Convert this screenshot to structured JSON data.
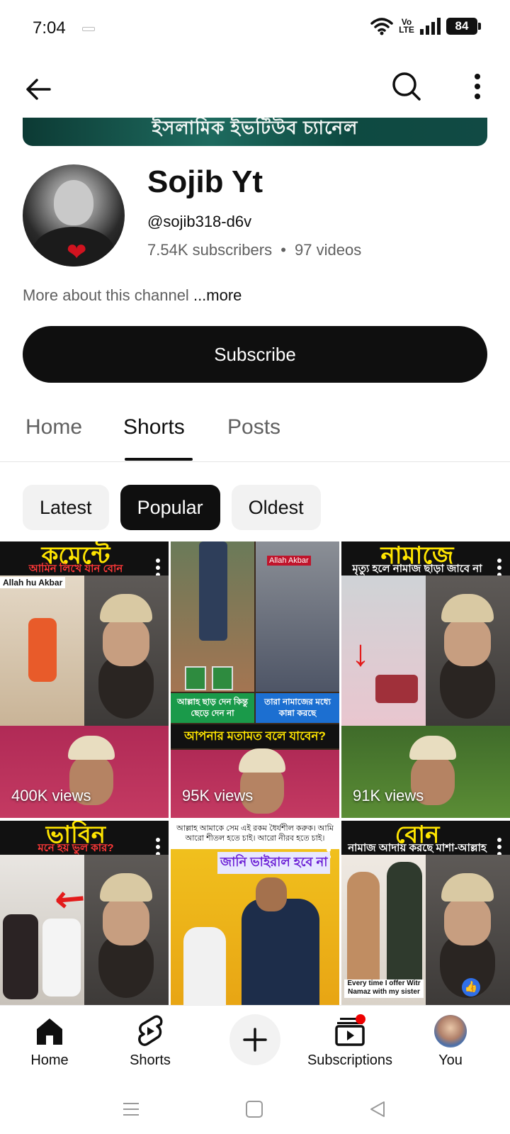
{
  "status_bar": {
    "time": "7:04",
    "network": "Vo LTE",
    "battery": "84"
  },
  "app_bar": {
    "back_icon": "arrow-back-icon",
    "search_icon": "search-icon",
    "more_icon": "more-vertical-icon"
  },
  "banner": {
    "text": "ইসলামিক ইভটিউব চ্যানেল"
  },
  "channel": {
    "name": "Sojib Yt",
    "handle": "@sojib318-d6v",
    "subscribers": "7.54K subscribers",
    "separator": "•",
    "videos": "97 videos",
    "more_about": "More about this channel",
    "more_link": "...more"
  },
  "subscribe_label": "Subscribe",
  "tabs": [
    {
      "label": "Home"
    },
    {
      "label": "Shorts"
    },
    {
      "label": "Posts"
    }
  ],
  "active_tab": "Shorts",
  "chips": [
    {
      "label": "Latest"
    },
    {
      "label": "Popular"
    },
    {
      "label": "Oldest"
    }
  ],
  "active_chip": "Popular",
  "shorts": [
    {
      "headline": "কমেন্টে",
      "subline": "আমিন লিখে যান বোন",
      "caption": "Allah hu Akbar",
      "views": "400K views"
    },
    {
      "headline": "",
      "subline": "",
      "caption": "Allah Akbar",
      "band_left": "আল্লাহ ছাড় দেন কিন্তু ছেড়ে দেন না",
      "band_right": "তারা নামাজের মধ্যে কান্না করছে",
      "band_mid": "আপনার মতামত বলে যাবেন?",
      "views": "95K views"
    },
    {
      "headline": "নামাজে",
      "subline": "মৃত্যু হলে নামাজ ছাড়া জাবে না",
      "caption": "",
      "views": "91K views"
    },
    {
      "headline": "ভাবিন",
      "subline": "মনে হয় ভুল কার?",
      "caption": "",
      "views": ""
    },
    {
      "headline": "",
      "subline": "জানি ভাইরাল হবে না",
      "caption": "আল্লাহ আমাকে সেম এই রকম ধৈর্যশীল করুক। আমি আরো শীতল হতে চাই। আরো নীরব হতে চাই।",
      "views": ""
    },
    {
      "headline": "বোন",
      "subline": "নামাজ আদায় করছে মাশা-আল্লাহ",
      "caption": "Every time I offer Witr Namaz with my sister",
      "views": ""
    }
  ],
  "bottom_nav": [
    {
      "label": "Home",
      "icon": "home-icon"
    },
    {
      "label": "Shorts",
      "icon": "shorts-icon"
    },
    {
      "label": "",
      "icon": "create-plus-icon"
    },
    {
      "label": "Subscriptions",
      "icon": "subscriptions-icon"
    },
    {
      "label": "You",
      "icon": "profile-avatar-icon"
    }
  ],
  "colors": {
    "primary": "#0f0f0f",
    "secondary_text": "#606060",
    "chip_bg": "#f2f2f2",
    "thumb_headline": "#ffe500",
    "thumb_subline": "#ff3838",
    "notification_dot": "#e00000"
  }
}
